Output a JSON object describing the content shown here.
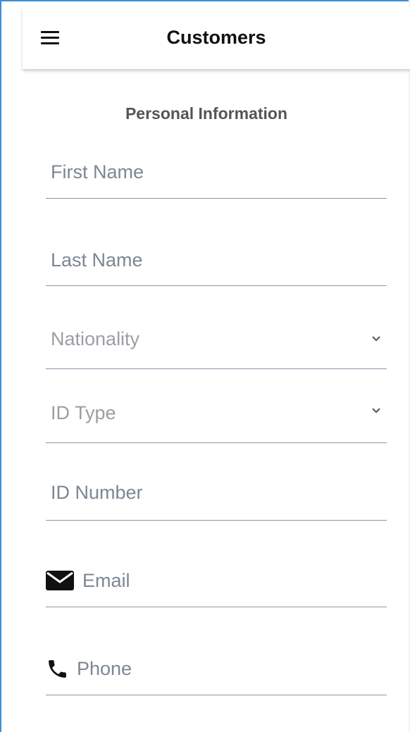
{
  "header": {
    "title": "Customers",
    "menu_icon": "menu-icon"
  },
  "form": {
    "section_title": "Personal Information",
    "first_name": {
      "placeholder": "First Name",
      "value": ""
    },
    "last_name": {
      "placeholder": "Last Name",
      "value": ""
    },
    "nationality": {
      "placeholder": "Nationality",
      "icon": "chevron-down-icon"
    },
    "id_type": {
      "placeholder": "ID Type",
      "icon": "chevron-down-icon"
    },
    "id_number": {
      "placeholder": "ID Number",
      "value": ""
    },
    "email": {
      "placeholder": "Email",
      "value": "",
      "icon": "envelope-icon"
    },
    "phone": {
      "placeholder": "Phone",
      "value": "",
      "icon": "phone-icon"
    }
  },
  "colors": {
    "frame_border": "#3b8fd6",
    "underline": "#8a95a8",
    "placeholder": "#7c8794",
    "select_placeholder": "#9a9ea4",
    "section_title": "#555555"
  }
}
